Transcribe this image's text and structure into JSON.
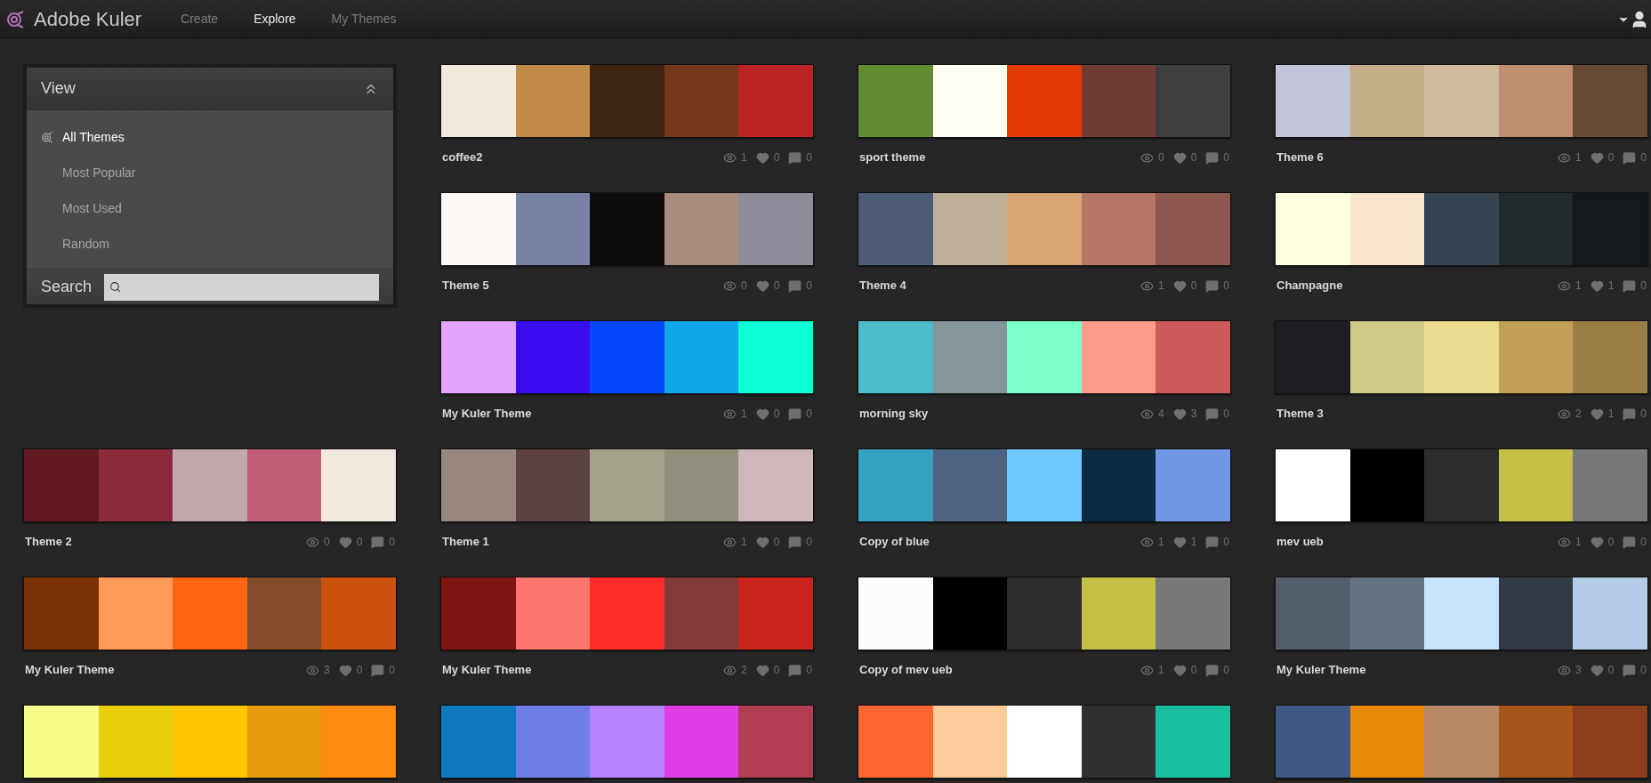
{
  "brand": "Adobe Kuler",
  "nav": [
    {
      "label": "Create",
      "selected": false
    },
    {
      "label": "Explore",
      "selected": true
    },
    {
      "label": "My Themes",
      "selected": false
    }
  ],
  "sidebar": {
    "title": "View",
    "items": [
      {
        "label": "All Themes",
        "selected": true
      },
      {
        "label": "Most Popular",
        "selected": false
      },
      {
        "label": "Most Used",
        "selected": false
      },
      {
        "label": "Random",
        "selected": false
      }
    ],
    "search_label": "Search"
  },
  "themes": [
    {
      "name": "coffee2",
      "views": "1",
      "likes": "0",
      "comments": "0",
      "swatches": [
        {
          "color": "#f1e8dc"
        },
        {
          "color": "#c08a47"
        },
        {
          "color": "#3e2411"
        },
        {
          "color": "#74391c"
        },
        {
          "color": "#bb2325"
        }
      ]
    },
    {
      "name": "sport theme",
      "views": "0",
      "likes": "0",
      "comments": "0",
      "swatches": [
        {
          "color": "#628b33"
        },
        {
          "color": "#fdfff0"
        },
        {
          "color": "#e33a05"
        },
        {
          "color": "#6f3d35"
        },
        {
          "color": "#3e3e3e"
        }
      ]
    },
    {
      "name": "Theme 6",
      "views": "1",
      "likes": "0",
      "comments": "0",
      "swatches": [
        {
          "color": "#c1c5d7"
        },
        {
          "color": "#c4ad87"
        },
        {
          "color": "#cfbb9c"
        },
        {
          "color": "#c08f70"
        },
        {
          "color": "#684a33"
        }
      ]
    },
    {
      "name": "Theme 5",
      "views": "0",
      "likes": "0",
      "comments": "0",
      "swatches": [
        {
          "color": "#fdf8f6"
        },
        {
          "color": "#7882a6"
        },
        {
          "color": "#0d0b0c"
        },
        {
          "color": "#a98b80"
        },
        {
          "color": "#8e8c98"
        }
      ]
    },
    {
      "name": "Theme 4",
      "views": "1",
      "likes": "0",
      "comments": "0",
      "swatches": [
        {
          "color": "#4c5c78"
        },
        {
          "color": "#beb197"
        },
        {
          "color": "#d8a574"
        },
        {
          "color": "#b47763"
        },
        {
          "color": "#8d574f"
        }
      ]
    },
    {
      "name": "Champagne",
      "views": "1",
      "likes": "1",
      "comments": "0",
      "swatches": [
        {
          "color": "#feffdf"
        },
        {
          "color": "#f7e6cc"
        },
        {
          "color": "#354450"
        },
        {
          "color": "#212b2b"
        },
        {
          "color": "#141a1b"
        }
      ]
    },
    {
      "name": "My Kuler Theme",
      "views": "1",
      "likes": "0",
      "comments": "0",
      "swatches": [
        {
          "color": "#e3a4fe"
        },
        {
          "color": "#3a0cf0"
        },
        {
          "color": "#0547fe"
        },
        {
          "color": "#0fa6ea"
        },
        {
          "color": "#0cffd5"
        }
      ]
    },
    {
      "name": "morning sky",
      "views": "4",
      "likes": "3",
      "comments": "0",
      "swatches": [
        {
          "color": "#4fbccb"
        },
        {
          "color": "#85969a"
        },
        {
          "color": "#7dffca"
        },
        {
          "color": "#ff9c8e"
        },
        {
          "color": "#cc5a5a"
        }
      ]
    },
    {
      "name": "Theme 3",
      "views": "2",
      "likes": "1",
      "comments": "0",
      "swatches": [
        {
          "color": "#1e1e23"
        },
        {
          "color": "#ccc98a"
        },
        {
          "color": "#ecdb8e"
        },
        {
          "color": "#c2a058"
        },
        {
          "color": "#9c7f45"
        }
      ]
    },
    {
      "name": "Theme 2",
      "views": "0",
      "likes": "0",
      "comments": "0",
      "swatches": [
        {
          "color": "#611a22"
        },
        {
          "color": "#8b2a3b"
        },
        {
          "color": "#c1a8ad"
        },
        {
          "color": "#c05e78"
        },
        {
          "color": "#f2e9de"
        }
      ]
    },
    {
      "name": "Theme 1",
      "views": "1",
      "likes": "0",
      "comments": "0",
      "swatches": [
        {
          "color": "#978780"
        },
        {
          "color": "#5b4140"
        },
        {
          "color": "#a2a189"
        },
        {
          "color": "#918f7b"
        },
        {
          "color": "#cdb7b8"
        }
      ]
    },
    {
      "name": "Copy of blue",
      "views": "1",
      "likes": "1",
      "comments": "0",
      "swatches": [
        {
          "color": "#35a2c1"
        },
        {
          "color": "#4e6382"
        },
        {
          "color": "#6fc9ff"
        },
        {
          "color": "#0b2b44"
        },
        {
          "color": "#7197e6"
        }
      ]
    },
    {
      "name": "mev ueb",
      "views": "1",
      "likes": "0",
      "comments": "0",
      "swatches": [
        {
          "color": "#ffffff"
        },
        {
          "color": "#000000"
        },
        {
          "color": "#2b2d2c"
        },
        {
          "color": "#c4c048"
        },
        {
          "color": "#787878"
        }
      ]
    },
    {
      "name": "My Kuler Theme",
      "views": "3",
      "likes": "0",
      "comments": "0",
      "swatches": [
        {
          "color": "#7d3106"
        },
        {
          "color": "#ff9a5a"
        },
        {
          "color": "#ff6610"
        },
        {
          "color": "#834d2c"
        },
        {
          "color": "#cd520f"
        }
      ]
    },
    {
      "name": "My Kuler Theme",
      "views": "2",
      "likes": "0",
      "comments": "0",
      "swatches": [
        {
          "color": "#7f1512"
        },
        {
          "color": "#ff766e"
        },
        {
          "color": "#ff2c25"
        },
        {
          "color": "#823a3a"
        },
        {
          "color": "#c9251e"
        }
      ]
    },
    {
      "name": "Copy of mev ueb",
      "views": "1",
      "likes": "0",
      "comments": "0",
      "swatches": [
        {
          "color": "#fcfcfc"
        },
        {
          "color": "#000000"
        },
        {
          "color": "#2b2d2c"
        },
        {
          "color": "#c4c048"
        },
        {
          "color": "#787878"
        }
      ]
    },
    {
      "name": "My Kuler Theme",
      "views": "3",
      "likes": "0",
      "comments": "0",
      "swatches": [
        {
          "color": "#535e6a"
        },
        {
          "color": "#637382"
        },
        {
          "color": "#c6e5fd"
        },
        {
          "color": "#323a45"
        },
        {
          "color": "#b3cde8"
        }
      ]
    },
    {
      "swatches": [
        {
          "color": "#f8fd8c"
        },
        {
          "color": "#e9cf0c"
        },
        {
          "color": "#ffc600"
        },
        {
          "color": "#e89a0f"
        },
        {
          "color": "#ff8a0f"
        }
      ]
    },
    {
      "swatches": [
        {
          "color": "#0d7abf"
        },
        {
          "color": "#6e7ee6"
        },
        {
          "color": "#b682fe"
        },
        {
          "color": "#df3ee6"
        },
        {
          "color": "#b03e50"
        }
      ]
    },
    {
      "swatches": [
        {
          "color": "#ff6433"
        },
        {
          "color": "#ffcb98"
        },
        {
          "color": "#ffffff"
        },
        {
          "color": "#303030"
        },
        {
          "color": "#1abfa0"
        }
      ]
    },
    {
      "swatches": [
        {
          "color": "#3f5783"
        },
        {
          "color": "#e88a08"
        },
        {
          "color": "#b98967"
        },
        {
          "color": "#a65419"
        },
        {
          "color": "#8d3e1b"
        }
      ]
    }
  ]
}
